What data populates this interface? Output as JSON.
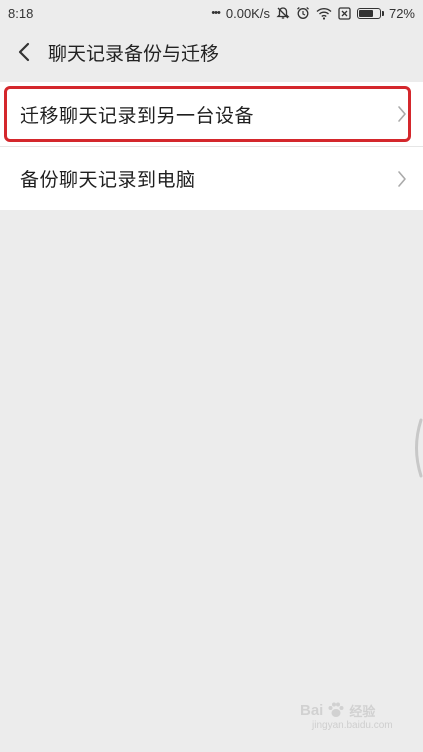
{
  "status_bar": {
    "time": "8:18",
    "dots": "•••",
    "speed": "0.00K/s",
    "battery_percent": "72%",
    "battery_level": 0.72,
    "icons": [
      "mute-bell-icon",
      "alarm-icon",
      "wifi-icon",
      "sim-x-icon",
      "battery-icon"
    ]
  },
  "header": {
    "back_icon": "chevron-left-icon",
    "title": "聊天记录备份与迁移"
  },
  "menu": {
    "items": [
      {
        "label": "迁移聊天记录到另一台设备",
        "highlighted": true,
        "icon": "chevron-right-icon"
      },
      {
        "label": "备份聊天记录到电脑",
        "highlighted": false,
        "icon": "chevron-right-icon"
      }
    ]
  },
  "watermark": {
    "text": "Bai",
    "suffix": "经验",
    "url": "jingyan.baidu.com"
  },
  "colors": {
    "background": "#ececec",
    "highlight": "#d4272c",
    "card": "#ffffff"
  }
}
